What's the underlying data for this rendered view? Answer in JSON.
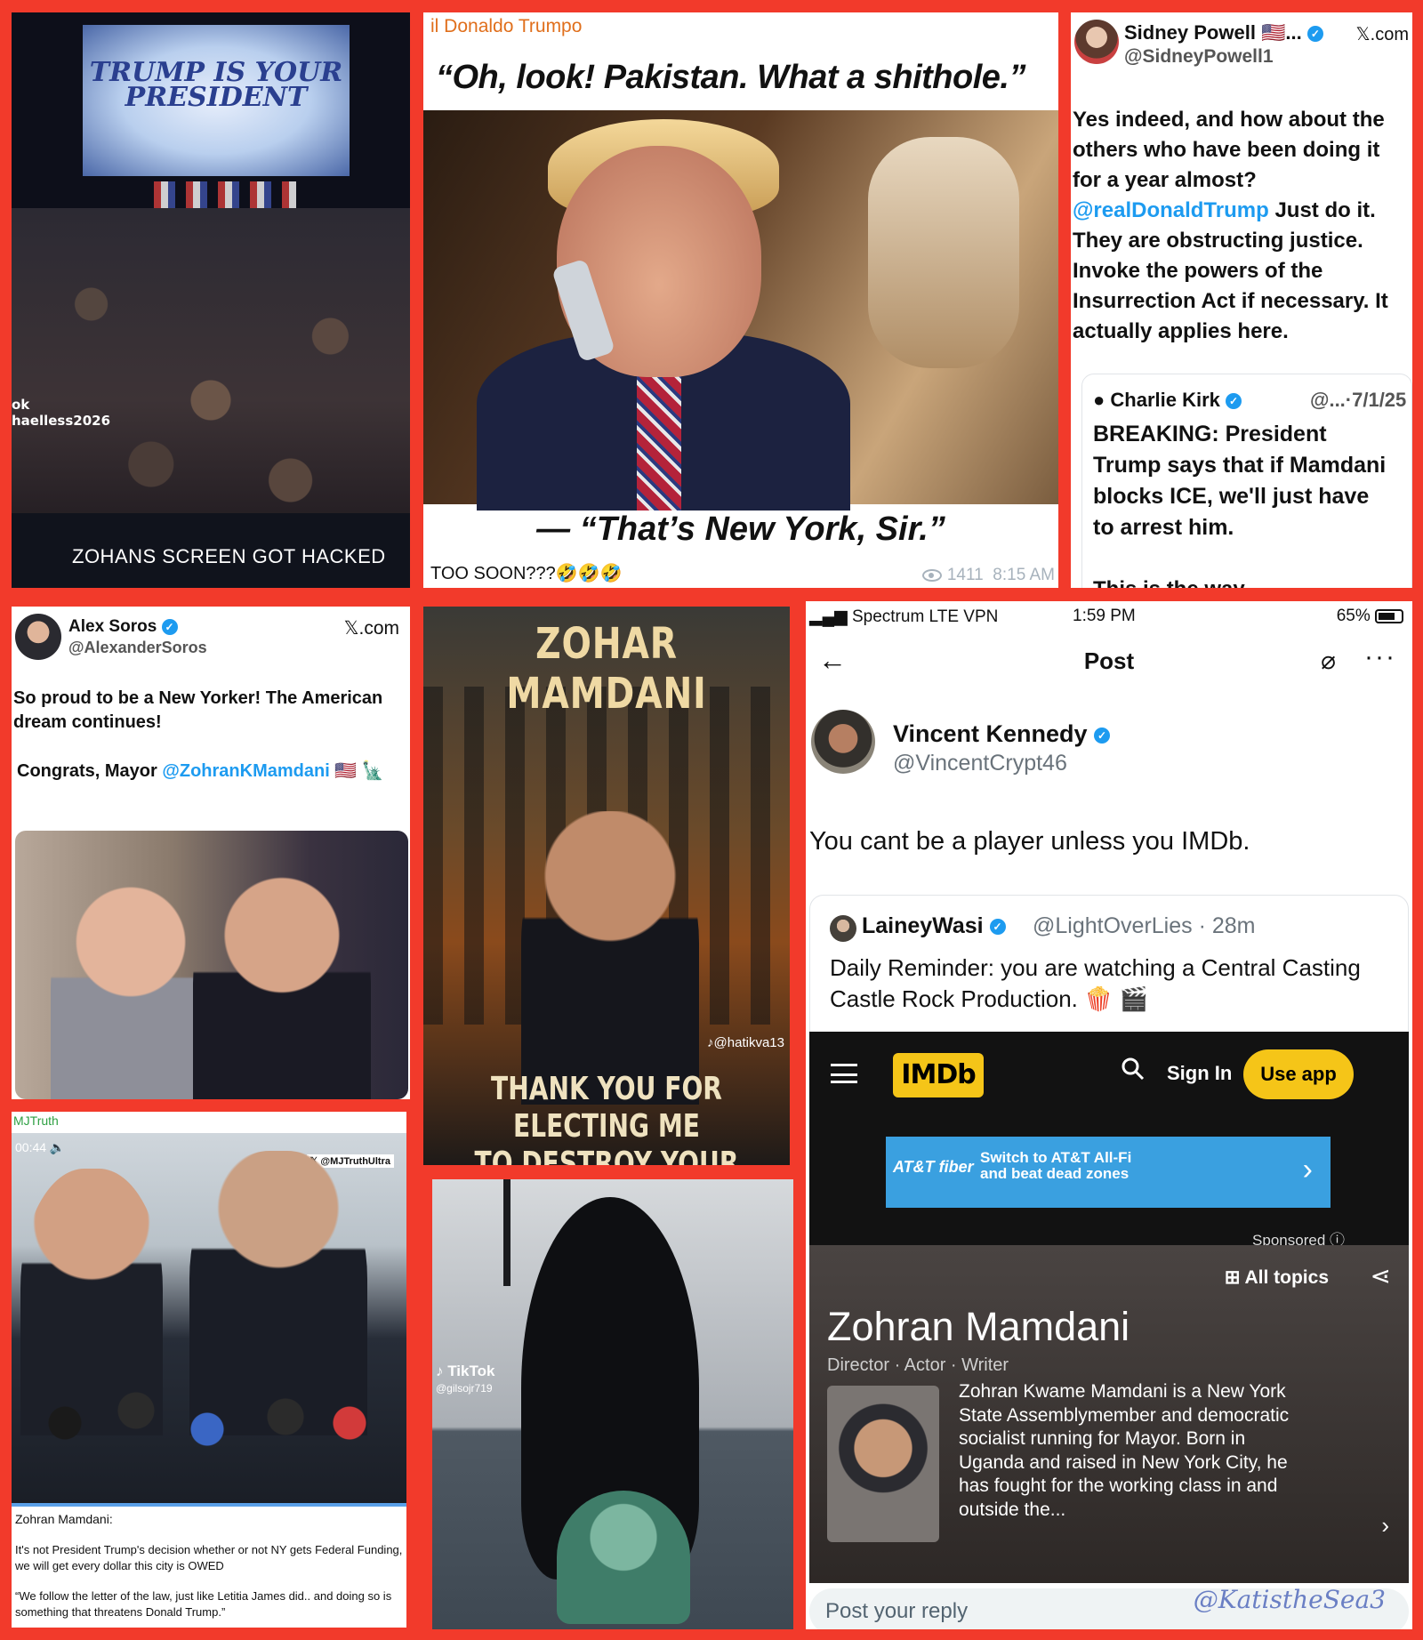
{
  "panel_crowd": {
    "screen_title": "TRUMP IS YOUR PRESIDENT",
    "handle": "ok\nhaelless2026",
    "caption": "ZOHANS SCREEN GOT HACKED"
  },
  "panel_trump": {
    "channel": "il Donaldo Trumpo",
    "quote_top": "“Oh, look! Pakistan. What a shithole.”",
    "quote_bottom": "— “That’s New York, Sir.”",
    "caption": "TOO SOON???🤣🤣🤣",
    "views": "1411",
    "time": "8:15 AM"
  },
  "panel_powell": {
    "name": "Sidney Powell 🇺🇸...",
    "handle": "@SidneyPowell1",
    "site": "𝕏.com",
    "body_1": "Yes indeed, and how about the others who have been doing it for a year almost?",
    "mention": "@realDonaldTrump",
    "body_2": " Just do it. They are obstructing justice. Invoke the powers of the Insurrection Act if necessary. It actually applies here.",
    "quoted_name": "Charlie Kirk",
    "quoted_handle": "@...·7/1/25",
    "quoted_body": "BREAKING: President Trump says that if Mamdani blocks ICE, we'll just have to arrest him.",
    "quoted_tail": "This is the way"
  },
  "panel_soros": {
    "name": "Alex Soros",
    "handle": "@AlexanderSoros",
    "site": "𝕏.com",
    "body": "So proud to be a New Yorker! The American dream continues!",
    "congrats_prefix": "Congrats, Mayor ",
    "mention": "@ZohranKMamdani",
    "congrats_suffix": " 🇺🇸 🗽"
  },
  "panel_poster": {
    "title": "ZOHAR MAMDANI",
    "tiktok": "♪@hatikva13",
    "bottom_1": "THANK YOU FOR ELECTING ME",
    "bottom_2": "TO DESTROY YOUR CITY"
  },
  "panel_mjtruth": {
    "channel": "MJTruth",
    "time": "00:44 🔈",
    "watermark": "𝕏 @MJTruthUltra",
    "speaker": "Zohran Mamdani:",
    "quote_1": "It's not President Trump's decision whether or not NY gets Federal Funding, we will get every dollar this city is OWED",
    "quote_2": "“We follow the letter of the law, just like Letitia James did.. and doing so is something that threatens Donald Trump.”"
  },
  "panel_statue": {
    "tiktok": "♪ TikTok",
    "handle": "@gilsojr719"
  },
  "panel_phone": {
    "carrier": "Spectrum LTE VPN",
    "time": "1:59 PM",
    "battery": "65%",
    "nav_title": "Post",
    "author": "Vincent Kennedy",
    "handle": "@VincentCrypt46",
    "tweet": "You cant be a player unless you IMDb.",
    "quoted_name": "LaineyWasi",
    "quoted_handle": "@LightOverLies · 28m",
    "quoted_body": "Daily Reminder: you are watching a Central Casting Castle Rock Production. 🍿 🎬",
    "imdb_logo": "IMDb",
    "sign_in": "Sign In",
    "use_app": "Use app",
    "ad_brand": "AT&T fiber",
    "ad_line1": "Switch to AT&T All-Fi",
    "ad_line2": "and beat dead zones",
    "sponsored": "Sponsored ⓘ",
    "all_topics": "All topics",
    "person_name": "Zohran Mamdani",
    "roles": "Director · Actor · Writer",
    "bio": "Zohran Kwame Mamdani is a New York State Assemblymember and democratic socialist running for Mayor. Born in Uganda and raised in New York City, he has fought for the working class in and outside the...",
    "reply_placeholder": "Post your reply",
    "signature": "@KatistheSea3"
  },
  "colors": {
    "border": "#f23a2b",
    "link_blue": "#1d9bf0",
    "imdb_yellow": "#f5c518"
  }
}
